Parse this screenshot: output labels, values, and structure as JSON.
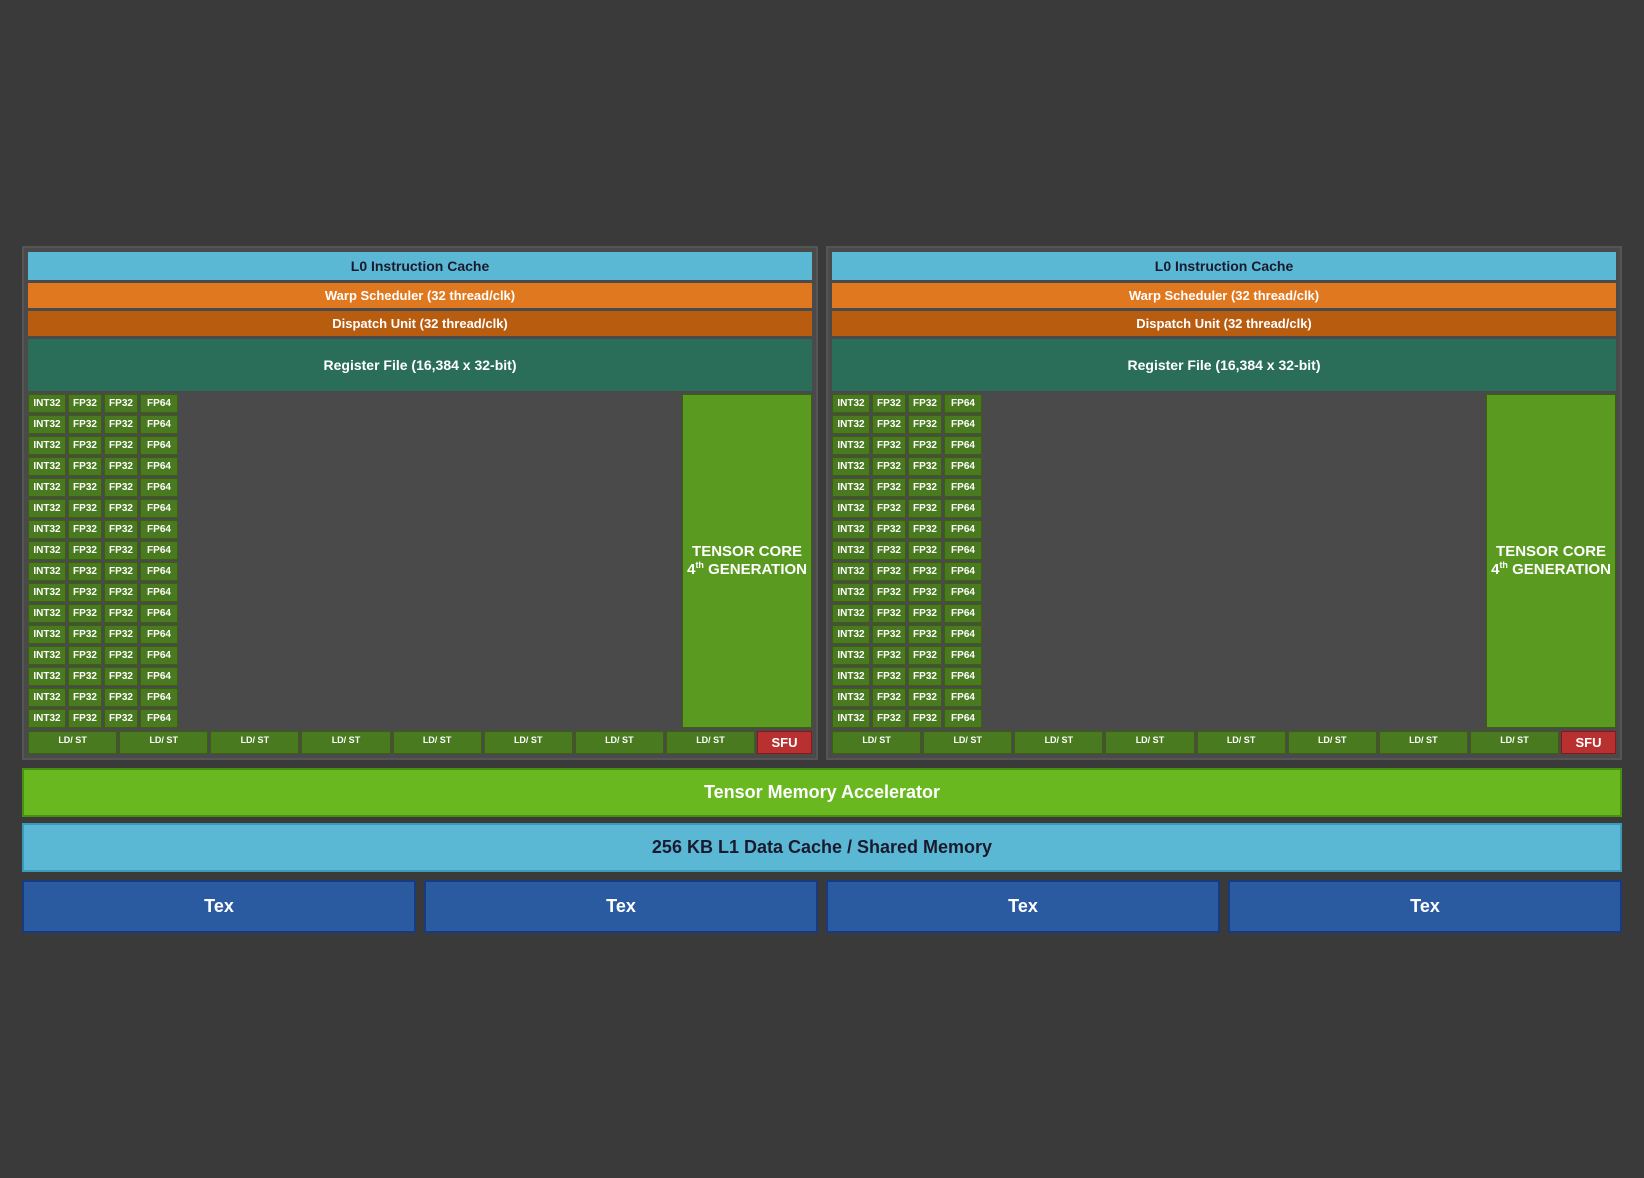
{
  "colors": {
    "l0_cache_bg": "#5bb8d4",
    "warp_scheduler_bg": "#e07820",
    "dispatch_unit_bg": "#b85c10",
    "register_file_bg": "#2a6e5a",
    "compute_bg": "#4a7a20",
    "tensor_core_bg": "#5a9a20",
    "sfu_bg": "#b83030",
    "tma_bg": "#6ab820",
    "l1_cache_bg": "#5bb8d4",
    "tex_bg": "#2a5aa0"
  },
  "sm_block": {
    "l0_cache_label": "L0 Instruction Cache",
    "warp_scheduler_label": "Warp Scheduler (32 thread/clk)",
    "dispatch_unit_label": "Dispatch Unit (32 thread/clk)",
    "register_file_label": "Register File (16,384 x 32-bit)"
  },
  "compute_rows": [
    [
      "INT32",
      "FP32",
      "FP32",
      "FP64"
    ],
    [
      "INT32",
      "FP32",
      "FP32",
      "FP64"
    ],
    [
      "INT32",
      "FP32",
      "FP32",
      "FP64"
    ],
    [
      "INT32",
      "FP32",
      "FP32",
      "FP64"
    ],
    [
      "INT32",
      "FP32",
      "FP32",
      "FP64"
    ],
    [
      "INT32",
      "FP32",
      "FP32",
      "FP64"
    ],
    [
      "INT32",
      "FP32",
      "FP32",
      "FP64"
    ],
    [
      "INT32",
      "FP32",
      "FP32",
      "FP64"
    ],
    [
      "INT32",
      "FP32",
      "FP32",
      "FP64"
    ],
    [
      "INT32",
      "FP32",
      "FP32",
      "FP64"
    ],
    [
      "INT32",
      "FP32",
      "FP32",
      "FP64"
    ],
    [
      "INT32",
      "FP32",
      "FP32",
      "FP64"
    ],
    [
      "INT32",
      "FP32",
      "FP32",
      "FP64"
    ],
    [
      "INT32",
      "FP32",
      "FP32",
      "FP64"
    ],
    [
      "INT32",
      "FP32",
      "FP32",
      "FP64"
    ],
    [
      "INT32",
      "FP32",
      "FP32",
      "FP64"
    ]
  ],
  "tensor_core": {
    "line1": "TENSOR CORE",
    "line2": "4",
    "sup": "th",
    "line3": "GENERATION"
  },
  "ldst_cells": [
    "LD/\nST",
    "LD/\nST",
    "LD/\nST",
    "LD/\nST",
    "LD/\nST",
    "LD/\nST",
    "LD/\nST",
    "LD/\nST"
  ],
  "sfu_label": "SFU",
  "tma_label": "Tensor Memory Accelerator",
  "l1_cache_label": "256 KB L1 Data Cache / Shared Memory",
  "tex_labels": [
    "Tex",
    "Tex",
    "Tex",
    "Tex"
  ]
}
